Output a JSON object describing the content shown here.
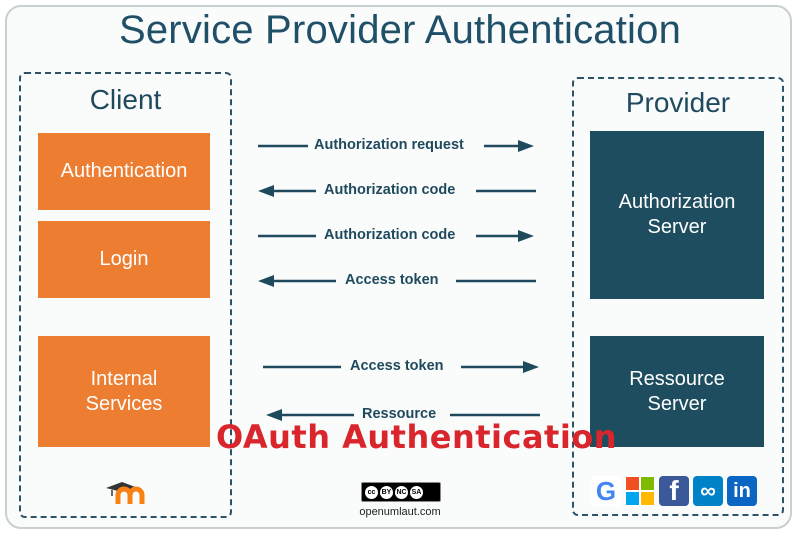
{
  "title": "Service Provider Authentication",
  "client": {
    "title": "Client",
    "boxes": [
      {
        "label": "Authentication"
      },
      {
        "label": "Login"
      },
      {
        "label_line1": "Internal",
        "label_line2": "Services"
      }
    ]
  },
  "provider": {
    "title": "Provider",
    "boxes": [
      {
        "label_line1": "Authorization",
        "label_line2": "Server"
      },
      {
        "label_line1": "Ressource",
        "label_line2": "Server"
      }
    ]
  },
  "flows": [
    {
      "label": "Authorization request",
      "direction": "right"
    },
    {
      "label": "Authorization code",
      "direction": "left"
    },
    {
      "label": "Authorization code",
      "direction": "right"
    },
    {
      "label": "Access token",
      "direction": "left"
    },
    {
      "label": "Access token",
      "direction": "right"
    },
    {
      "label": "Ressource",
      "direction": "left"
    }
  ],
  "watermark": "OAuth Authentication",
  "license": {
    "badge_items": [
      "cc",
      "BY",
      "NC",
      "SA"
    ],
    "url": "openumlaut.com"
  },
  "client_logo": {
    "icon": "moodle-icon",
    "text": "m"
  },
  "provider_logos": [
    {
      "icon": "google-icon",
      "text": "G",
      "color": "#4285f4"
    },
    {
      "icon": "microsoft-icon",
      "text": "",
      "color": "#f25022"
    },
    {
      "icon": "facebook-icon",
      "text": "f",
      "color": "#3b5998"
    },
    {
      "icon": "nextcloud-icon",
      "text": "∞",
      "color": "#0082c9"
    },
    {
      "icon": "linkedin-icon",
      "text": "in",
      "color": "#0a66c2"
    }
  ],
  "colors": {
    "client_box": "#ed7d31",
    "provider_box": "#1e4d5f",
    "title": "#1f5068",
    "watermark": "#d8262c"
  }
}
